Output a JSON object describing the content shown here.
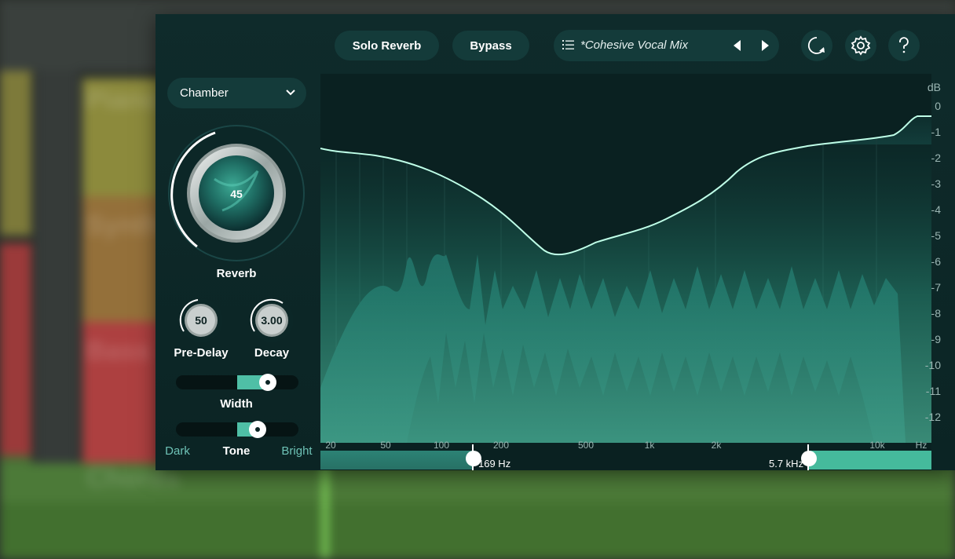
{
  "header": {
    "solo_label": "Solo Reverb",
    "bypass_label": "Bypass",
    "preset_name": "*Cohesive Vocal Mix"
  },
  "reverb_type": {
    "selected": "Chamber"
  },
  "knobs": {
    "reverb": {
      "label": "Reverb",
      "value": "45"
    },
    "predelay": {
      "label": "Pre-Delay",
      "value": "50"
    },
    "decay": {
      "label": "Decay",
      "value": "3.00"
    }
  },
  "sliders": {
    "width": {
      "label": "Width",
      "level": 0.75
    },
    "tone": {
      "label": "Tone",
      "left": "Dark",
      "right": "Bright",
      "level": 0.67
    }
  },
  "graph": {
    "db_unit": "dB",
    "db_ticks": [
      "0",
      "-1",
      "-2",
      "-3",
      "-4",
      "-5",
      "-6",
      "-7",
      "-8",
      "-9",
      "-10",
      "-11",
      "-12"
    ],
    "hz_unit": "Hz",
    "hz_ticks": [
      "20",
      "50",
      "100",
      "200",
      "500",
      "1k",
      "2k",
      "10k"
    ],
    "low_cut": "169 Hz",
    "high_cut": "5.7 kHz"
  },
  "colors": {
    "accent": "#4fbfa6",
    "panel": "#0f2b2b",
    "button": "#143b3a"
  },
  "icons": {
    "preset_list": "list-icon",
    "previous": "triangle-left-icon",
    "next": "triangle-right-icon",
    "refresh": "refresh-icon",
    "settings": "gear-icon",
    "help": "question-icon"
  }
}
